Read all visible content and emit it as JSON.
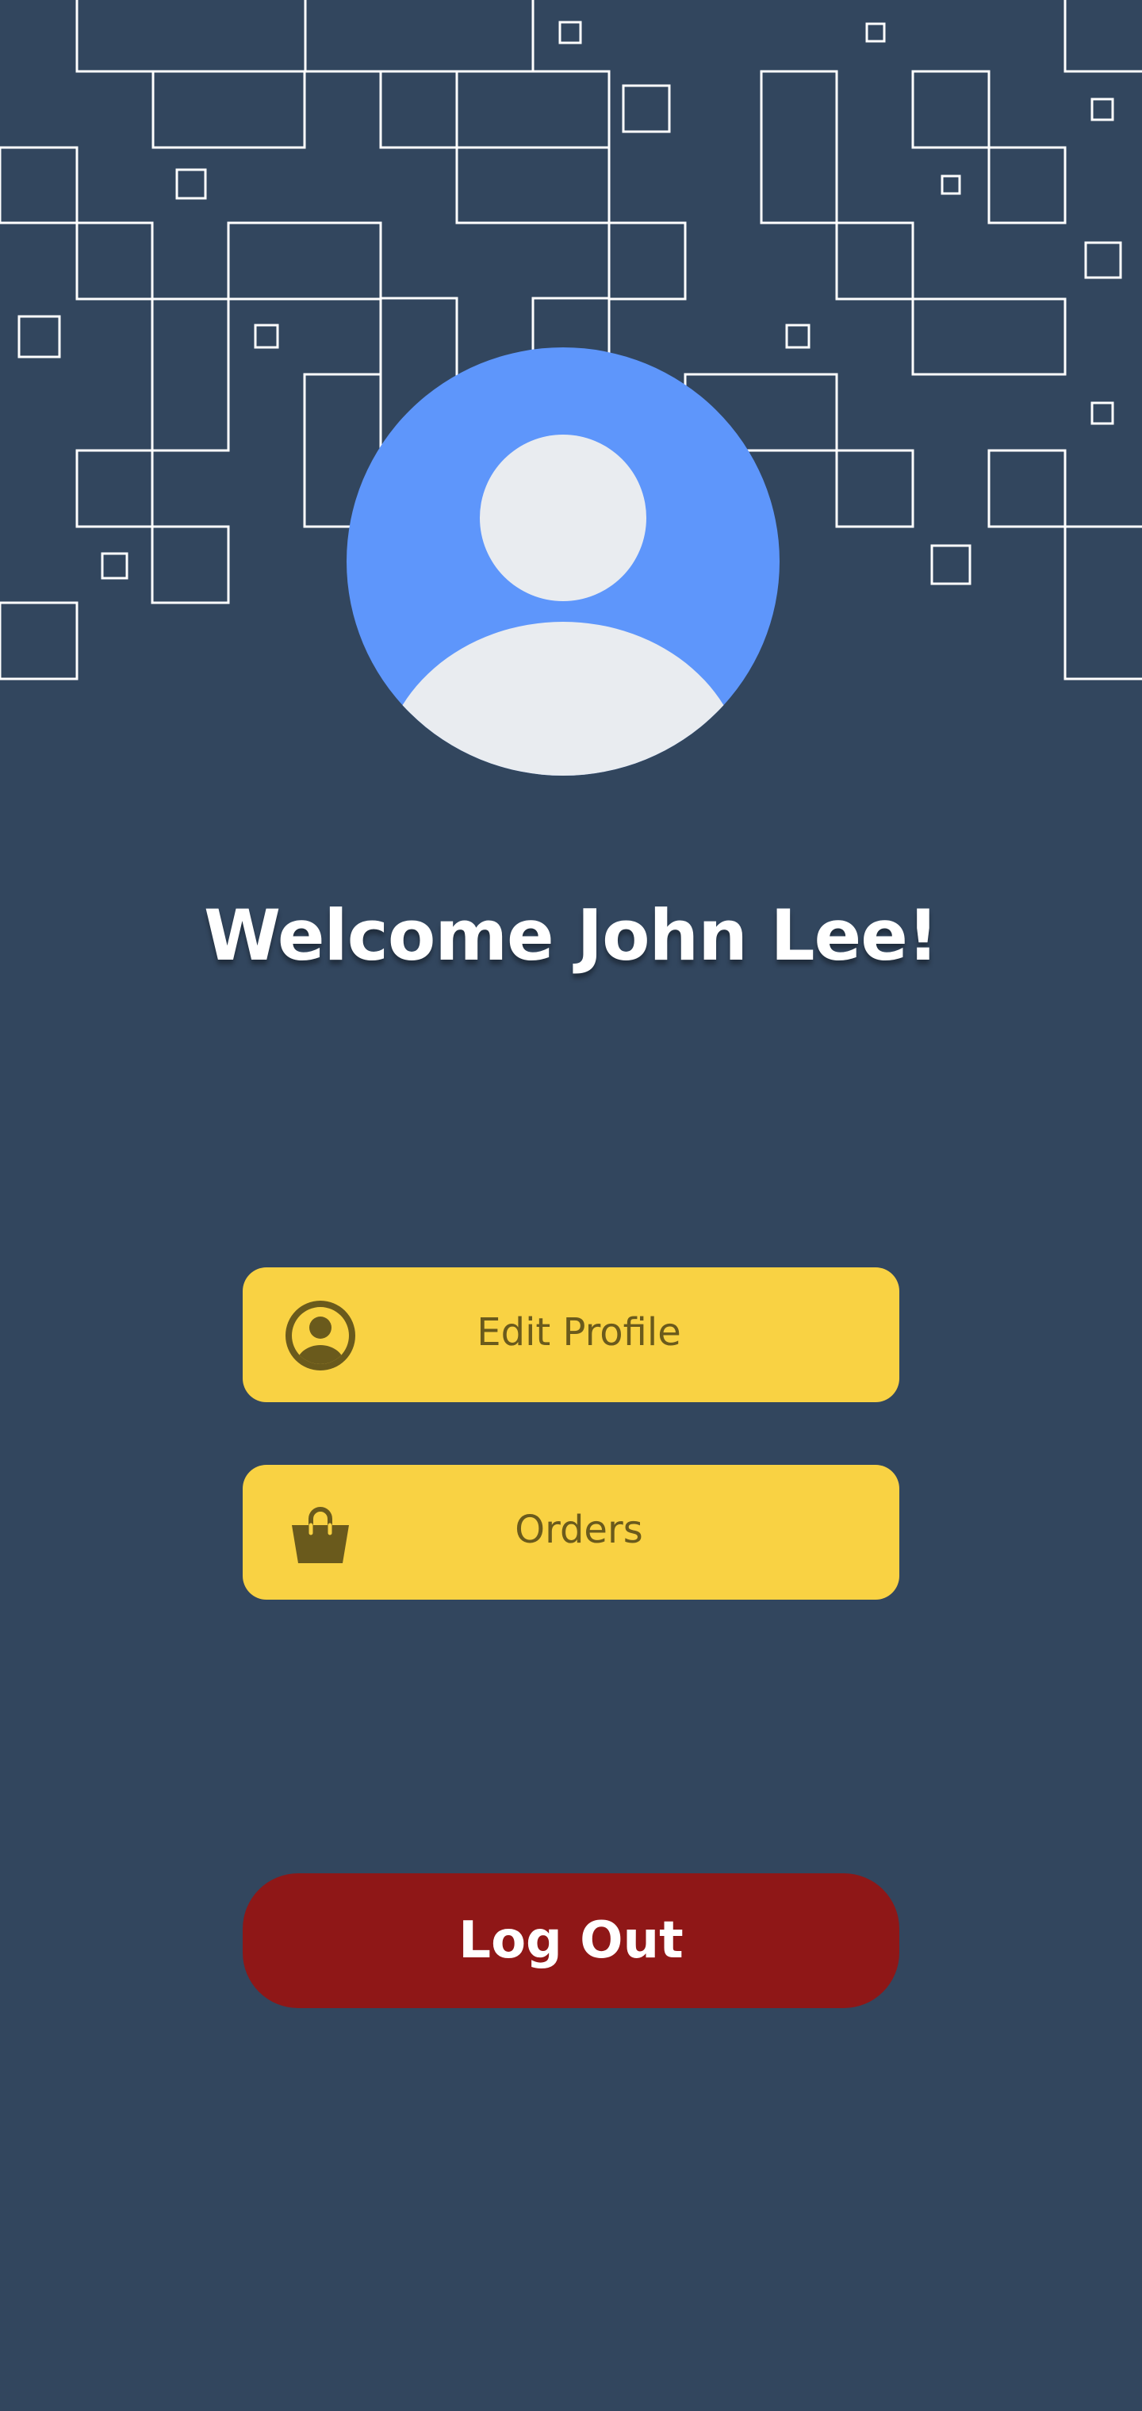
{
  "profile": {
    "welcome_text": "Welcome John Lee!",
    "avatar_icon": "user-avatar-icon"
  },
  "menu": {
    "edit_profile_label": "Edit Profile",
    "edit_profile_icon": "user-circle-icon",
    "orders_label": "Orders",
    "orders_icon": "shopping-bag-icon"
  },
  "logout": {
    "label": "Log Out"
  },
  "colors": {
    "background": "#32465e",
    "avatar_bg": "#5e96fb",
    "menu_button": "#f9d243",
    "menu_text": "#6a5a1c",
    "logout_button": "#8f1717"
  }
}
